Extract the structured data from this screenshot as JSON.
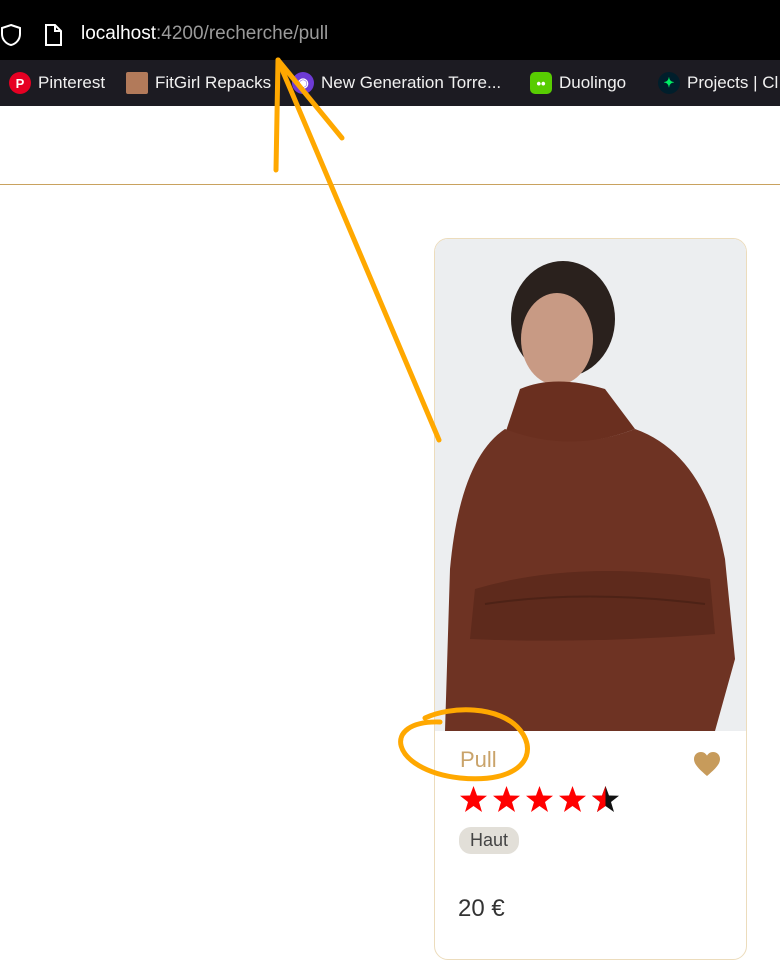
{
  "browser": {
    "url_host": "localhost",
    "url_path": ":4200/recherche/pull",
    "icons": {
      "security": "shield-icon",
      "page": "page-icon"
    }
  },
  "bookmarks": [
    {
      "label": "Pinterest",
      "icon": "pinterest-icon",
      "glyph": "P"
    },
    {
      "label": "FitGirl Repacks",
      "icon": "fitgirl-icon",
      "glyph": ""
    },
    {
      "label": "New Generation Torre...",
      "icon": "torrent-icon",
      "glyph": ""
    },
    {
      "label": "Duolingo",
      "icon": "duolingo-icon",
      "glyph": "••"
    },
    {
      "label": "Projects | Cl",
      "icon": "mongodb-leaf-icon",
      "glyph": ""
    }
  ],
  "product": {
    "title": "Pull",
    "rating": 4.5,
    "rating_max": 5,
    "tag": "Haut",
    "price": "20 €",
    "favorite": true,
    "favorite_icon": "heart-icon"
  },
  "colors": {
    "accent": "#c9a25f",
    "title": "#c9a36a",
    "heart": "#c79b5b",
    "star": "#ff0000",
    "annotation": "#ffa800"
  }
}
